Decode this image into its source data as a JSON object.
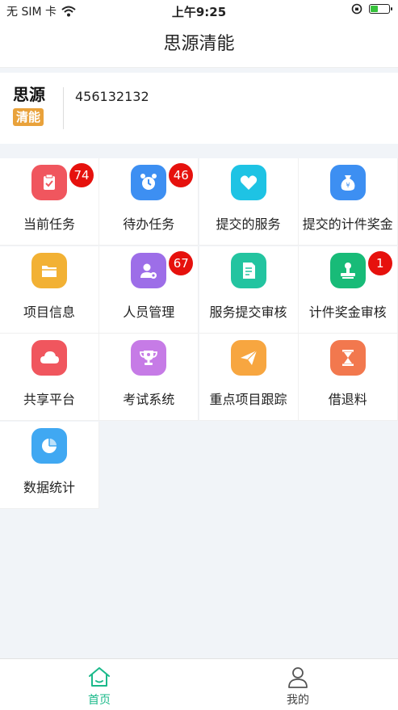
{
  "status_bar": {
    "carrier": "无 SIM 卡",
    "time": "上午9:25",
    "battery_level": 0.45
  },
  "header": {
    "title": "思源清能"
  },
  "profile": {
    "logo_line1": "思源",
    "logo_line2": "清能",
    "account": "456132132"
  },
  "grid": {
    "items": [
      {
        "label": "当前任务",
        "badge": "74",
        "color": "#f0565e",
        "icon": "clipboard-check-icon"
      },
      {
        "label": "待办任务",
        "badge": "46",
        "color": "#3d8ff2",
        "icon": "alarm-clock-icon"
      },
      {
        "label": "提交的服务",
        "badge": "",
        "color": "#1ec3e4",
        "icon": "heart-icon"
      },
      {
        "label": "提交的计件奖金",
        "badge": "",
        "color": "#3d8ff2",
        "icon": "money-bag-icon"
      },
      {
        "label": "项目信息",
        "badge": "",
        "color": "#f2b134",
        "icon": "folder-icon"
      },
      {
        "label": "人员管理",
        "badge": "67",
        "color": "#9d6ee8",
        "icon": "user-settings-icon"
      },
      {
        "label": "服务提交审核",
        "badge": "",
        "color": "#23c4a0",
        "icon": "document-icon"
      },
      {
        "label": "计件奖金审核",
        "badge": "1",
        "color": "#18bb78",
        "icon": "stamp-icon"
      },
      {
        "label": "共享平台",
        "badge": "",
        "color": "#f0565e",
        "icon": "cloud-icon"
      },
      {
        "label": "考试系统",
        "badge": "",
        "color": "#c67be6",
        "icon": "trophy-icon"
      },
      {
        "label": "重点项目跟踪",
        "badge": "",
        "color": "#f7a640",
        "icon": "paper-plane-icon"
      },
      {
        "label": "借退料",
        "badge": "",
        "color": "#f2784e",
        "icon": "hourglass-icon"
      },
      {
        "label": "数据统计",
        "badge": "",
        "color": "#40a8f2",
        "icon": "pie-chart-icon"
      }
    ]
  },
  "tab_bar": {
    "active_color": "#1bb98a",
    "tabs": [
      {
        "label": "首页",
        "icon": "home-icon",
        "active": true
      },
      {
        "label": "我的",
        "icon": "person-icon",
        "active": false
      }
    ]
  }
}
